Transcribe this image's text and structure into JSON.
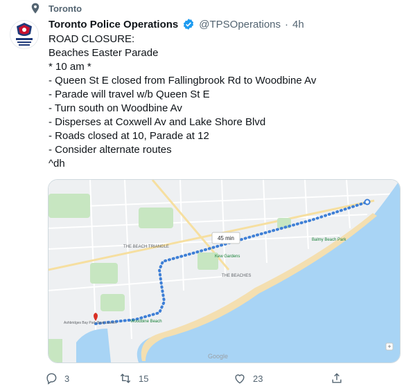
{
  "context": {
    "label": "Toronto",
    "icon": "location-pin-icon"
  },
  "author": {
    "display_name": "Toronto Police Operations",
    "handle": "@TPSOperations",
    "separator": "·",
    "time": "4h",
    "verified": true,
    "avatar_text_top": "TORONTO POLICE",
    "avatar_text_bottom": "OPERATIONS CENTRE"
  },
  "tweet": {
    "lines": [
      "ROAD CLOSURE:",
      "Beaches Easter Parade",
      "* 10 am *",
      "- Queen St E closed from Fallingbrook Rd to Woodbine Av",
      "- Parade will travel w/b Queen St E",
      "- Turn south on Woodbine Av",
      "- Disperses at Coxwell Av and Lake Shore Blvd",
      "- Roads closed at 10, Parade at 12",
      "- Consider alternate routes",
      "^dh"
    ]
  },
  "map": {
    "labels": {
      "neighbourhood": "THE BEACH TRIANGLE",
      "beaches": "THE BEACHES",
      "woodbine_beach": "Woodbine Beach",
      "ashbridges": "Ashbridges Bay Park Boat Launch",
      "kew_gardens": "Kew Gardens",
      "balmy_beach": "Balmy Beach Park",
      "duration": "45 min",
      "google": "Google"
    },
    "colors": {
      "water": "#a8d4f5",
      "land": "#eef0f2",
      "park": "#c7e6c1",
      "route": "#3e7fd6",
      "sand": "#f4dfb0"
    }
  },
  "actions": {
    "reply": {
      "icon": "reply-icon",
      "count": "3"
    },
    "retweet": {
      "icon": "retweet-icon",
      "count": "15"
    },
    "like": {
      "icon": "like-icon",
      "count": "23"
    },
    "share": {
      "icon": "share-icon"
    }
  }
}
